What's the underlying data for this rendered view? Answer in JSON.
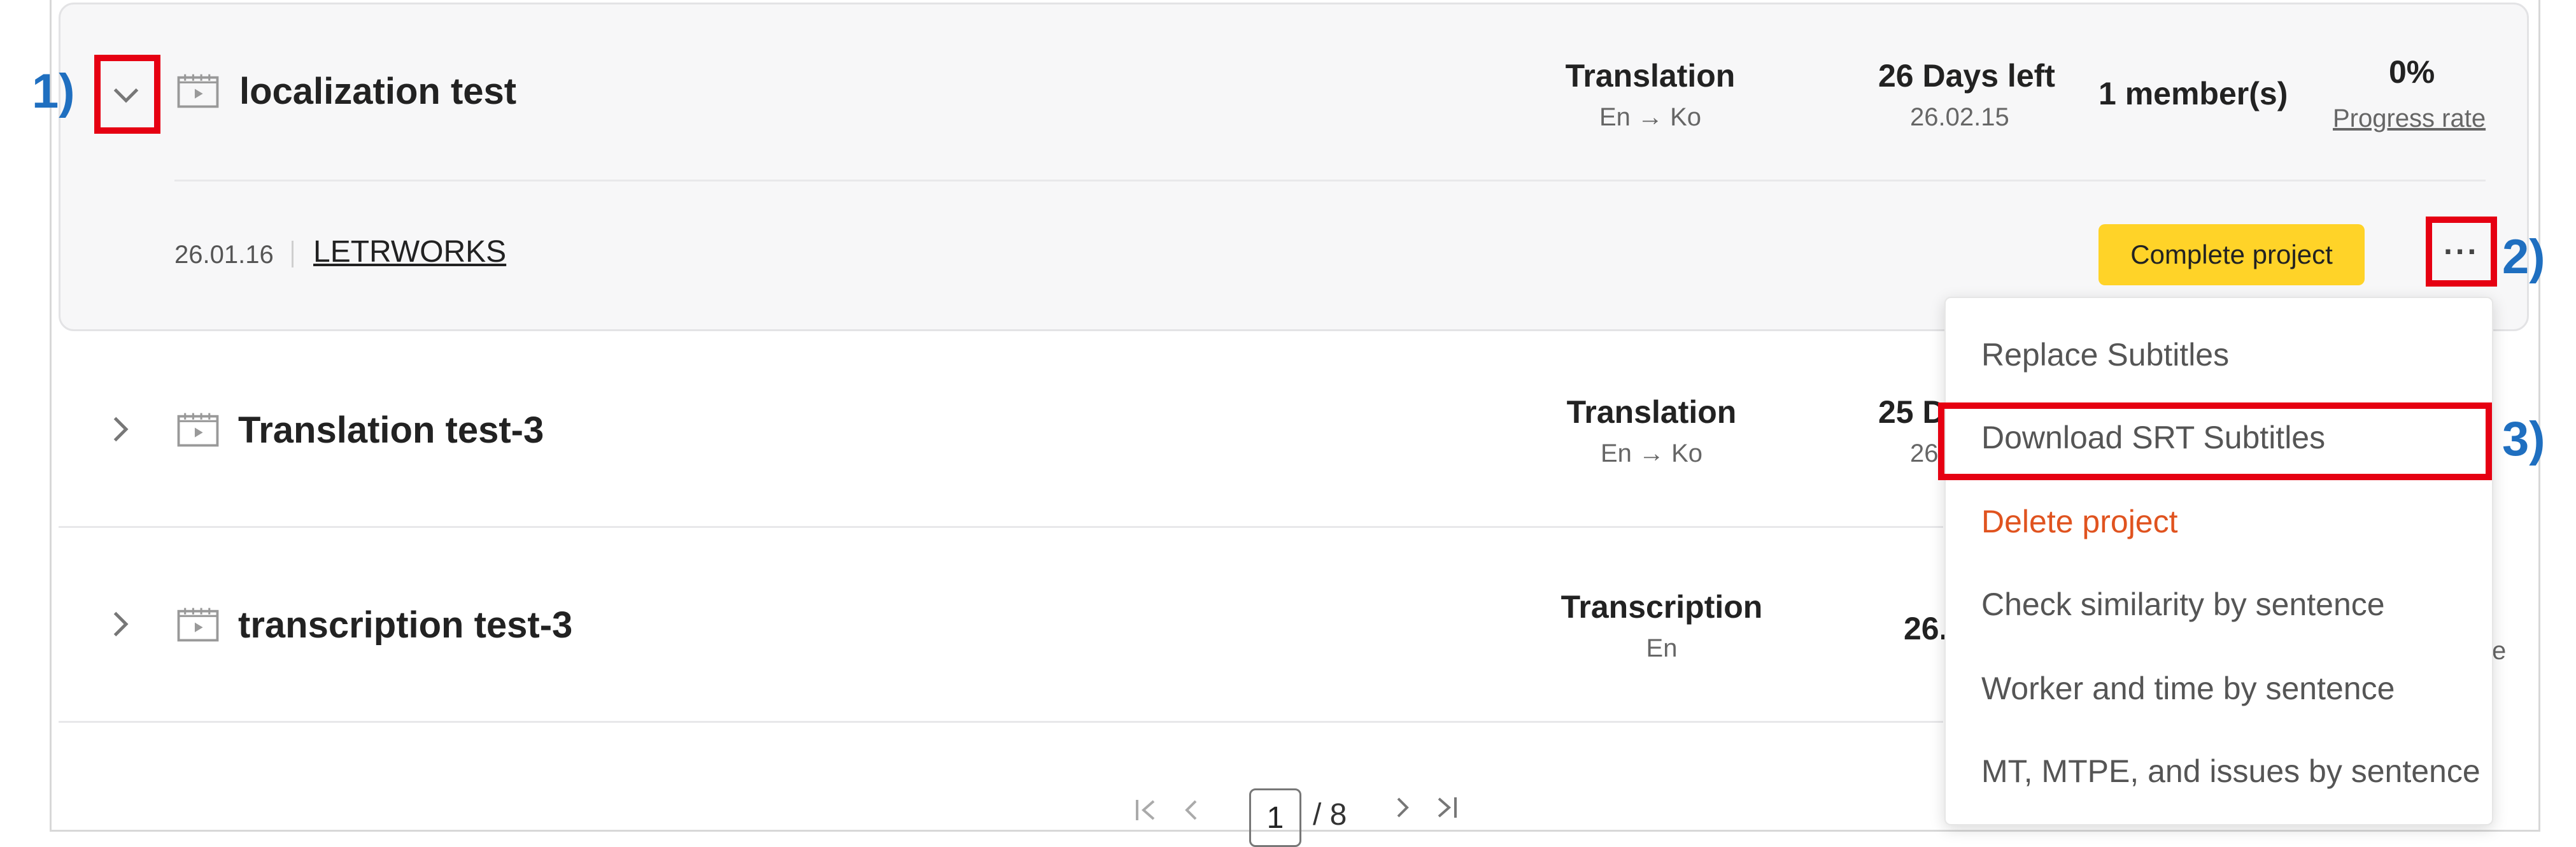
{
  "annotations": {
    "marker_1": "1)",
    "marker_2": "2)",
    "marker_3": "3)"
  },
  "projects": [
    {
      "title": "localization test",
      "kind": "Translation",
      "lang": "En → Ko",
      "deadline": "26 Days left",
      "due_date": "26.01.16",
      "due_date_short": "26.02.15",
      "members": "1 member(s)",
      "progress": "0%",
      "progress_label": "Progress rate",
      "created": "26.01.16",
      "company": "LETRWORKS",
      "expanded": true
    },
    {
      "title": "Translation test-3",
      "kind": "Translation",
      "lang": "En → Ko",
      "deadline_partial": "25 D",
      "date_partial": "26"
    },
    {
      "title": "transcription test-3",
      "kind": "Transcription",
      "lang": "En",
      "deadline_partial": "26.",
      "progress_partial": "e"
    }
  ],
  "actions": {
    "complete_label": "Complete project",
    "more_label": "···"
  },
  "menu": {
    "items": [
      "Replace Subtitles",
      "Download SRT Subtitles",
      "Delete project",
      "Check similarity by sentence",
      "Worker and time by sentence",
      "MT, MTPE, and issues by sentence"
    ]
  },
  "pagination": {
    "current": "1",
    "total": "/ 8"
  },
  "colors": {
    "highlight": "#e60012",
    "marker": "#1f6fc0",
    "accent": "#ffd328",
    "danger": "#e0531f"
  }
}
